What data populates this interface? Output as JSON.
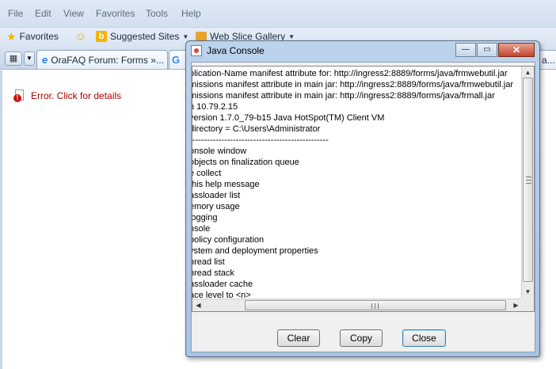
{
  "menu": [
    "File",
    "Edit",
    "View",
    "Favorites",
    "Tools",
    "Help"
  ],
  "favorites_bar": {
    "favorites_label": "Favorites",
    "suggested_sites": "Suggested Sites",
    "web_slice_gallery": "Web Slice Gallery"
  },
  "tabs": [
    {
      "label": "OraFAQ Forum: Forms »...",
      "icon": "ie-icon"
    },
    {
      "label": "G",
      "icon": "google-icon"
    },
    {
      "label": "a...",
      "icon": "page-icon"
    }
  ],
  "page": {
    "error_text": "Error. Click for details"
  },
  "console": {
    "title": "Java Console",
    "lines": [
      "plication-Name manifest attribute for: http://ingress2:8889/forms/java/frmwebutil.jar",
      "missions manifest attribute in main jar: http://ingress2:8889/forms/java/frmwebutil.jar",
      "missions manifest attribute in main jar: http://ingress2:8889/forms/java/frmall.jar",
      "n 10.79.2.15",
      "version 1.7.0_79-b15 Java HotSpot(TM) Client VM",
      " directory = C:\\Users\\Administrator",
      "------------------------------------------------",
      "onsole window",
      " objects on finalization queue",
      "e collect",
      " this help message",
      "assloader list",
      "emory usage",
      " logging",
      "nsole",
      "policy configuration",
      "ystem and deployment properties",
      "hread list",
      "hread stack",
      "assloader cache",
      "ace level to <n>",
      "------------------------------------------------"
    ],
    "buttons": {
      "clear": "Clear",
      "copy": "Copy",
      "close": "Close"
    },
    "window_controls": {
      "minimize": "—",
      "restore": "▭",
      "close": "✕"
    }
  }
}
